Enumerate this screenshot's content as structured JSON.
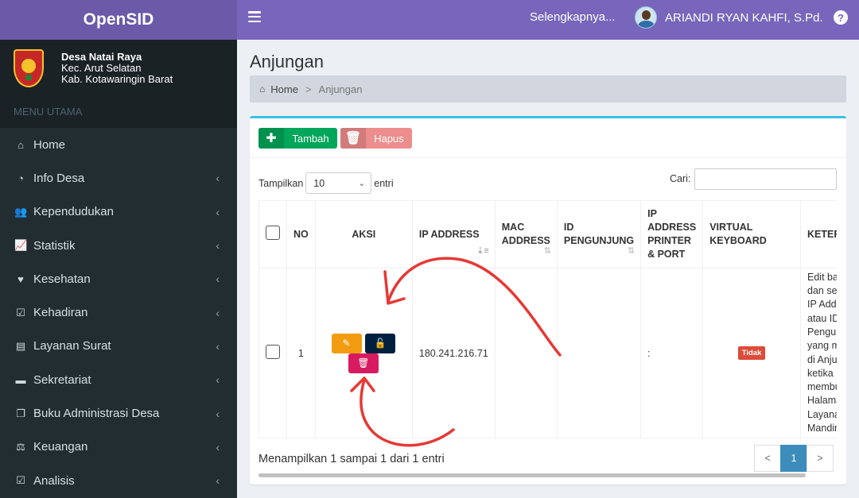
{
  "app": {
    "title": "OpenSID"
  },
  "topbar": {
    "more_link": "Selengkapnya...",
    "user_name": "ARIANDI RYAN KAHFI, S.Pd.",
    "help_icon": "question-circle-icon"
  },
  "village": {
    "name": "Desa Natai Raya",
    "district": "Kec. Arut Selatan",
    "regency": "Kab. Kotawaringin Barat"
  },
  "sidebar": {
    "header": "MENU UTAMA",
    "items": [
      {
        "label": "Home",
        "icon": "home-icon",
        "glyph": "⌂",
        "has_children": false
      },
      {
        "label": "Info Desa",
        "icon": "dashboard-icon",
        "glyph": "◔",
        "has_children": true
      },
      {
        "label": "Kependudukan",
        "icon": "users-icon",
        "glyph": "👥",
        "has_children": true
      },
      {
        "label": "Statistik",
        "icon": "line-chart-icon",
        "glyph": "📈",
        "has_children": true
      },
      {
        "label": "Kesehatan",
        "icon": "heartbeat-icon",
        "glyph": "♥",
        "has_children": true
      },
      {
        "label": "Kehadiran",
        "icon": "calendar-check-icon",
        "glyph": "☑",
        "has_children": true
      },
      {
        "label": "Layanan Surat",
        "icon": "book-icon",
        "glyph": "▤",
        "has_children": true
      },
      {
        "label": "Sekretariat",
        "icon": "archive-icon",
        "glyph": "▬",
        "has_children": true
      },
      {
        "label": "Buku Administrasi Desa",
        "icon": "copy-icon",
        "glyph": "❐",
        "has_children": true
      },
      {
        "label": "Keuangan",
        "icon": "balance-scale-icon",
        "glyph": "⚖",
        "has_children": true
      },
      {
        "label": "Analisis",
        "icon": "check-square-icon",
        "glyph": "☑",
        "has_children": true
      }
    ]
  },
  "page": {
    "title": "Anjungan"
  },
  "breadcrumb": {
    "home": "Home",
    "separator": ">",
    "current": "Anjungan"
  },
  "toolbar": {
    "add_label": "Tambah",
    "delete_label": "Hapus"
  },
  "table_controls": {
    "show_label": "Tampilkan",
    "page_size": "10",
    "entries_label": "entri",
    "search_label": "Cari:",
    "search_value": ""
  },
  "table": {
    "headers": [
      "NO",
      "AKSI",
      "IP ADDRESS",
      "MAC ADDRESS",
      "ID PENGUNJUNG",
      "IP ADDRESS PRINTER & PORT",
      "VIRTUAL KEYBOARD",
      "KETERANGAN"
    ],
    "rows": [
      {
        "no": "1",
        "ip_address": "180.241.216.71",
        "mac_address": "",
        "id_pengunjung": "",
        "printer": ":",
        "virtual_keyboard": "Tidak",
        "keterangan_lines": [
          "Edit baris",
          "dan sesu",
          "IP Addre",
          "atau ID",
          "Pengunju",
          "yang mu",
          "di Anjung",
          "ketika",
          "membuk",
          "Halamar",
          "Layanan",
          "Mandiri"
        ]
      }
    ]
  },
  "footer": {
    "info": "Menampilkan 1 sampai 1 dari 1 entri",
    "prev": "<",
    "current_page": "1",
    "next": ">"
  },
  "colors": {
    "accent": "#7766bb",
    "sidebar": "#222d32",
    "success": "#00a65a",
    "danger": "#dd4b39",
    "annotation": "#e53935"
  }
}
